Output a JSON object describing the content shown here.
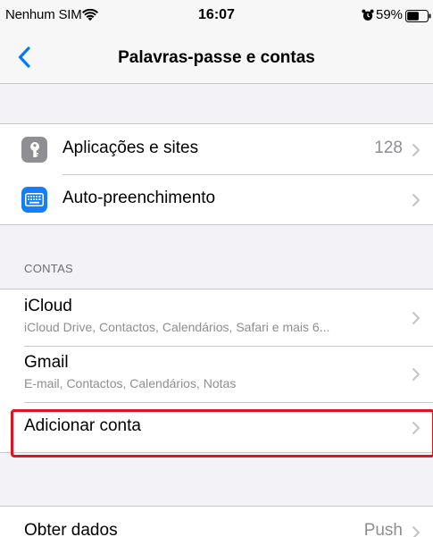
{
  "status_bar": {
    "carrier": "Nenhum SIM",
    "time": "16:07",
    "battery_percent": "59%",
    "battery_level": 0.59
  },
  "nav": {
    "title": "Palavras-passe e contas",
    "back_icon": "chevron-left-icon"
  },
  "passwords": {
    "items": [
      {
        "label": "Aplicações e sites",
        "value": "128",
        "icon": "key-icon"
      },
      {
        "label": "Auto-preenchimento",
        "value": "",
        "icon": "keyboard-icon"
      }
    ]
  },
  "accounts": {
    "header": "CONTAS",
    "items": [
      {
        "title": "iCloud",
        "subtitle": "iCloud Drive, Contactos, Calendários, Safari e mais 6..."
      },
      {
        "title": "Gmail",
        "subtitle": "E-mail, Contactos, Calendários, Notas"
      }
    ],
    "add_label": "Adicionar conta"
  },
  "fetch": {
    "label": "Obter dados",
    "value": "Push"
  },
  "colors": {
    "accent": "#007aff",
    "highlight": "#e0141e",
    "key_icon_bg": "#8e8e93",
    "keyboard_icon_bg": "#147efb"
  }
}
